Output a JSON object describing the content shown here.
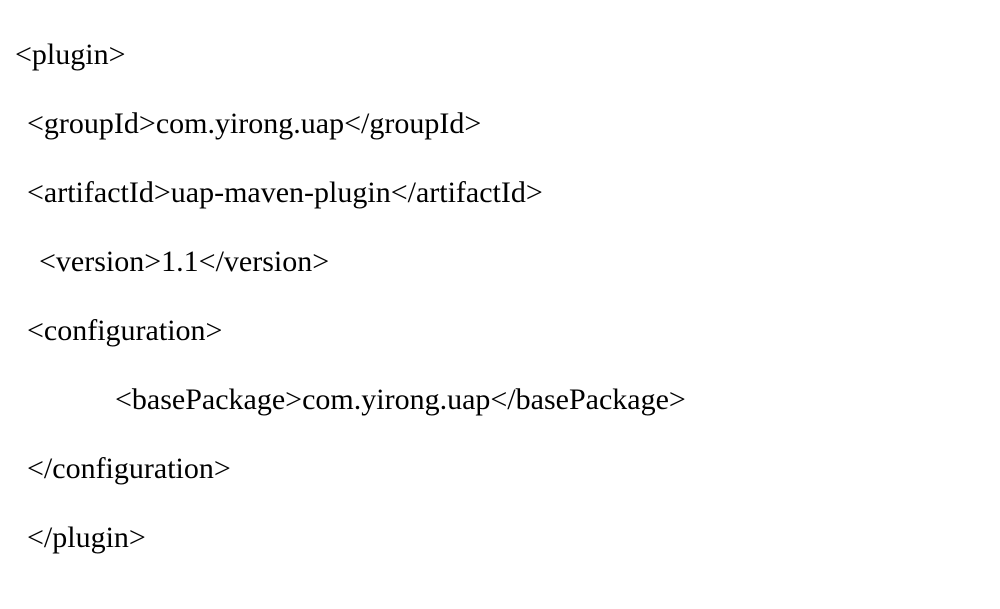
{
  "xml": {
    "plugin_open": "<plugin>",
    "groupId": "<groupId>com.yirong.uap</groupId>",
    "artifactId": "<artifactId>uap-maven-plugin</artifactId>",
    "version": "<version>1.1</version>",
    "configuration_open": "<configuration>",
    "basePackage": "<basePackage>com.yirong.uap</basePackage>",
    "configuration_close": "</configuration>",
    "plugin_close": "</plugin>"
  }
}
